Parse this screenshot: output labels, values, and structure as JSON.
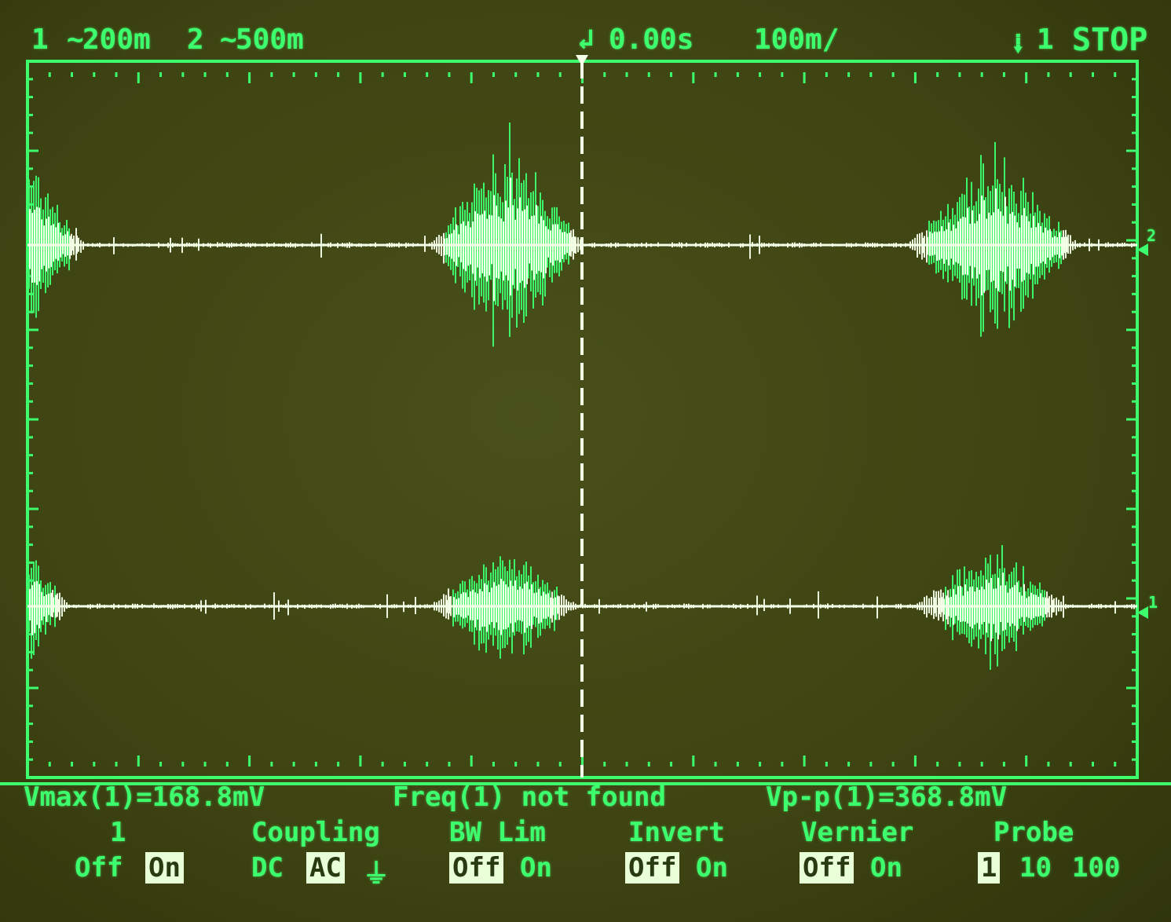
{
  "header": {
    "ch1_label": "1",
    "ch1_scale": "200m",
    "ch2_label": "2",
    "ch2_scale": "500m",
    "trigger_delay": "0.00s",
    "timebase": "100m/",
    "trigger_source": "1",
    "run_state": "STOP"
  },
  "measurements": {
    "vmax": "Vmax(1)=168.8mV",
    "freq": "Freq(1) not found",
    "vpp": "Vp-p(1)=368.8mV"
  },
  "menu": {
    "channel": {
      "title": "1",
      "off": "Off",
      "on": "On",
      "selected": "On"
    },
    "coupling": {
      "title": "Coupling",
      "dc": "DC",
      "ac": "AC",
      "gnd": "⏚",
      "selected": "AC"
    },
    "bw_lim": {
      "title": "BW Lim",
      "off": "Off",
      "on": "On",
      "selected": "Off"
    },
    "invert": {
      "title": "Invert",
      "off": "Off",
      "on": "On",
      "selected": "Off"
    },
    "vernier": {
      "title": "Vernier",
      "off": "Off",
      "on": "On",
      "selected": "Off"
    },
    "probe": {
      "title": "Probe",
      "x1": "1",
      "x10": "10",
      "x100": "100",
      "selected": "1"
    }
  },
  "markers": {
    "ch2_marker": "2",
    "ch1_marker": "1"
  },
  "colors": {
    "trace": "#3dff6e",
    "trace_core": "#ffffff",
    "background": "#3f4512"
  }
}
